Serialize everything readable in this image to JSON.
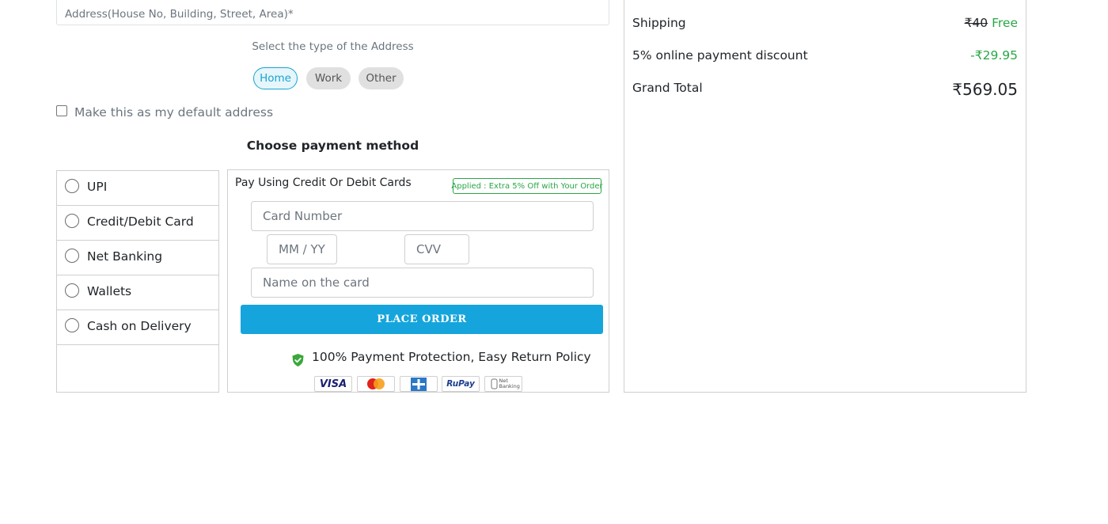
{
  "address": {
    "placeholder": "Address(House No, Building, Street, Area)*",
    "type_label": "Select the type of the Address",
    "types": [
      "Home",
      "Work",
      "Other"
    ],
    "selected_type": "Home",
    "default_label": "Make this as my default address"
  },
  "payment": {
    "title": "Choose payment method",
    "methods": [
      "UPI",
      "Credit/Debit Card",
      "Net Banking",
      "Wallets",
      "Cash on Delivery"
    ],
    "card": {
      "title": "Pay Using Credit Or Debit Cards",
      "applied": "Applied : Extra 5% Off with Your Order",
      "card_number_placeholder": "Card Number",
      "expiry_placeholder": "MM / YY",
      "cvv_placeholder": "CVV",
      "name_placeholder": "Name on the card",
      "place_order": "PLACE ORDER",
      "protection": "100% Payment Protection, Easy Return Policy",
      "logos": {
        "visa": "VISA",
        "rupay": "RuPay",
        "netbanking": "Net Banking"
      }
    }
  },
  "summary": {
    "shipping_label": "Shipping",
    "shipping_original": "₹40",
    "shipping_value": "Free",
    "discount_label": "5% online payment discount",
    "discount_value": "-₹29.95",
    "grand_total_label": "Grand Total",
    "grand_total_value": "₹569.05"
  },
  "colors": {
    "accent": "#15a5dc",
    "success": "#28a745",
    "border": "#cfcfcf"
  }
}
